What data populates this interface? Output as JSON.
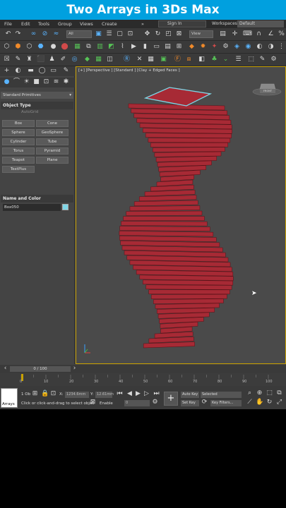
{
  "banner": {
    "title": "Two Arrays in 3Ds Max"
  },
  "menu": [
    "File",
    "Edit",
    "Tools",
    "Group",
    "Views",
    "Create"
  ],
  "menu_more": "»",
  "signin": "Sign In",
  "workspaces": {
    "label": "Workspaces:",
    "value": "Default"
  },
  "toolbar": {
    "filter": "All",
    "view": "View"
  },
  "panel": {
    "dropdown": "Standard Primitives",
    "object_type_header": "Object Type",
    "autogrid": "AutoGrid",
    "buttons": [
      "Box",
      "Cone",
      "Sphere",
      "GeoSphere",
      "Cylinder",
      "Tube",
      "Torus",
      "Pyramid",
      "Teapot",
      "Plane",
      "TextPlus"
    ],
    "name_color_header": "Name and Color",
    "object_name": "Box050"
  },
  "viewport": {
    "label": "[+] [Perspective ] [Standard ] [Clay + Edged Faces ]",
    "cube_label": "FRONT"
  },
  "timeline": {
    "slider": "0 / 100",
    "ticks": [
      "0",
      "10",
      "20",
      "30",
      "40",
      "50",
      "60",
      "70",
      "80",
      "90",
      "100"
    ]
  },
  "status": {
    "selected": "1 Ob",
    "x_label": "X:",
    "x_value": "1234.6mm",
    "y_label": "Y:",
    "y_value": "12.61mm",
    "hint": "Click or click-and-drag to select objec",
    "enable": "Enable",
    "frame": "0",
    "auto_key": "Auto Key",
    "set_key": "Set Key",
    "selected_dd": "Selected",
    "key_filters": "Key Filters...",
    "thumb_label": "Arrays"
  },
  "colors": {
    "banner": "#00a0df",
    "object": "#a72a35",
    "selection": "#7fd6e6"
  }
}
